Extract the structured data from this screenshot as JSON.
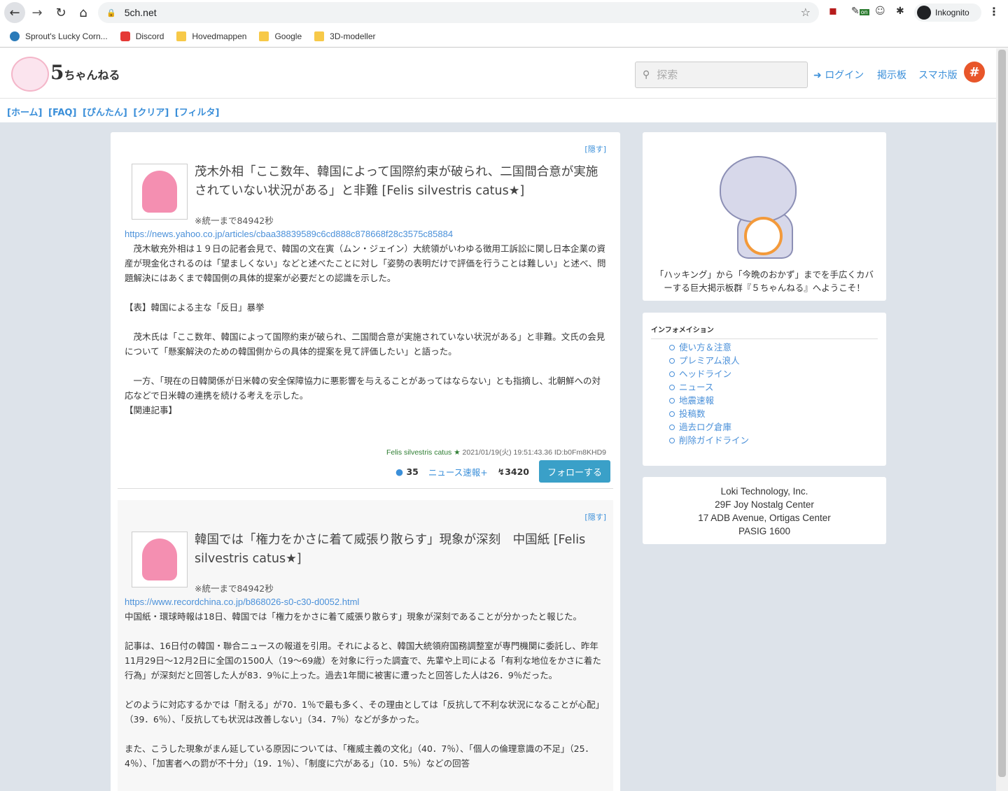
{
  "browser": {
    "url": "5ch.net",
    "incognito_label": "Inkognito",
    "ext_on_label": "on",
    "bookmarks": [
      {
        "label": "Sprout's Lucky Corn...",
        "icon": "wordpress-icon"
      },
      {
        "label": "Discord",
        "icon": "discord-icon"
      },
      {
        "label": "Hovedmappen",
        "icon": "folder-icon"
      },
      {
        "label": "Google",
        "icon": "folder-icon"
      },
      {
        "label": "3D-modeller",
        "icon": "folder-icon"
      }
    ]
  },
  "header": {
    "logo_text": "5",
    "logo_sub": "ちゃんねる",
    "search_placeholder": "探索",
    "login": "ログイン",
    "boards": "掲示板",
    "smartphone": "スマホ版",
    "hash": "#"
  },
  "subnav": [
    "[ホーム]",
    "[FAQ]",
    "[ぴんたん]",
    "[クリア]",
    "[フィルタ]"
  ],
  "articles": [
    {
      "hide": "[隠す]",
      "title": "茂木外相「ここ数年、韓国によって国際約束が破られ、二国間合意が実施されていない状況がある」と非難 [Felis silvestris catus★]",
      "sync": "※統一まで84942秒",
      "link": "https://news.yahoo.co.jp/articles/cbaa38839589c6cd888c878668f28c3575c85884",
      "body": "　茂木敏充外相は１９日の記者会見で、韓国の文在寅（ムン・ジェイン）大統領がいわゆる徴用工訴訟に関し日本企業の資産が現金化されるのは「望ましくない」などと述べたことに対し「姿勢の表明だけで評価を行うことは難しい」と述べ、問題解決にはあくまで韓国側の具体的提案が必要だとの認識を示した。\n\n【表】韓国による主な「反日」暴挙\n\n　茂木氏は「ここ数年、韓国によって国際約束が破られ、二国間合意が実施されていない状況がある」と非難。文氏の会見について「懸案解決のための韓国側からの具体的提案を見て評価したい」と語った。\n\n　一方、「現在の日韓関係が日米韓の安全保障協力に悪影響を与えることがあってはならない」とも指摘し、北朝鮮への対応などで日米韓の連携を続ける考えを示した。\n【関連記事】",
      "author": "Felis silvestris catus ★",
      "meta": "2021/01/19(火) 19:51:43.36 ID:b0Fm8KHD9",
      "comments": "35",
      "category": "ニュース速報+",
      "views": "3420",
      "follow": "フォローする"
    },
    {
      "hide": "[隠す]",
      "title": "韓国では「権力をかさに着て威張り散らす」現象が深刻　中国紙 [Felis silvestris catus★]",
      "sync": "※統一まで84942秒",
      "link": "https://www.recordchina.co.jp/b868026-s0-c30-d0052.html",
      "body": "中国紙・環球時報は18日、韓国では「権力をかさに着て威張り散らす」現象が深刻であることが分かったと報じた。\n\n記事は、16日付の韓国・聯合ニュースの報道を引用。それによると、韓国大統領府国務調整室が専門機関に委託し、昨年11月29日～12月2日に全国の1500人（19～69歳）を対象に行った調査で、先輩や上司による「有利な地位をかさに着た行為」が深刻だと回答した人が83．9％に上った。過去1年間に被害に遭ったと回答した人は26．9％だった。\n\nどのように対応するかでは「耐える」が70．1％で最も多く、その理由としては「反抗して不利な状況になることが心配」（39．6％）、「反抗しても状況は改善しない」（34．7％）などが多かった。\n\nまた、こうした現象がまん延している原因については、「権威主義の文化」（40．7％）、「個人の倫理意識の不足」（25．4％）、「加害者への罰が不十分」（19．1％）、「制度に穴がある」（10．5％）などの回答"
    }
  ],
  "sidebar": {
    "welcome": "「ハッキング」から「今晩のおかず」までを手広くカバーする巨大掲示板群『５ちゃんねる』へようこそ！",
    "info_title": "インフォメイション",
    "info_items": [
      "使い方＆注意",
      "プレミアム浪人",
      "ヘッドライン",
      "ニュース",
      "地震速報",
      "投稿数",
      "過去ログ倉庫",
      "削除ガイドライン"
    ],
    "company": [
      "Loki Technology, Inc.",
      "29F Joy Nostalg Center",
      "17 ADB Avenue, Ortigas Center",
      "PASIG 1600"
    ]
  }
}
